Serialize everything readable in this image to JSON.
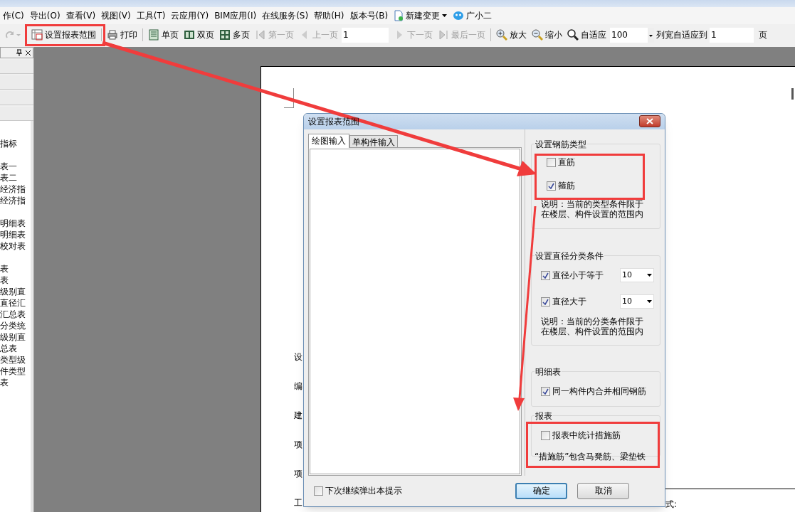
{
  "menu_bar": [
    {
      "label": "作(C)"
    },
    {
      "label": "导出(O)"
    },
    {
      "label": "查看(V)"
    },
    {
      "label": "视图(V)"
    },
    {
      "label": "工具(T)"
    },
    {
      "label": "云应用(Y)"
    },
    {
      "label": "BIM应用(I)"
    },
    {
      "label": "在线服务(S)"
    },
    {
      "label": "帮助(H)"
    },
    {
      "label": "版本号(B)"
    },
    {
      "label": "新建变更",
      "kind": "dropdown"
    },
    {
      "label": "广小二",
      "kind": "assistant"
    }
  ],
  "toolbar": [
    {
      "kind": "redo",
      "disabled": true
    },
    {
      "kind": "button",
      "label": "设置报表范围",
      "disabled": false
    },
    {
      "kind": "button",
      "label": "打印",
      "disabled": false
    },
    {
      "kind": "button",
      "label": "单页",
      "disabled": false
    },
    {
      "kind": "button",
      "label": "双页",
      "disabled": false
    },
    {
      "kind": "button",
      "label": "多页",
      "disabled": false
    },
    {
      "kind": "button",
      "label": "第一页",
      "disabled": true
    },
    {
      "kind": "button",
      "label": "上一页",
      "disabled": true
    },
    {
      "kind": "field",
      "value": "1"
    },
    {
      "kind": "button",
      "label": "下一页",
      "disabled": true
    },
    {
      "kind": "button",
      "label": "最后一页",
      "disabled": true
    },
    {
      "kind": "button",
      "label": "放大",
      "disabled": false
    },
    {
      "kind": "button",
      "label": "缩小",
      "disabled": false
    },
    {
      "kind": "button",
      "label": "自适应",
      "disabled": false
    },
    {
      "kind": "dropdown",
      "value": "100"
    },
    {
      "kind": "label",
      "label": "列宽自适应到"
    },
    {
      "kind": "field",
      "value": "1"
    },
    {
      "kind": "label",
      "label": "页"
    }
  ],
  "side_panel": {
    "groups": [
      {
        "items": [
          "指标"
        ]
      },
      {
        "items": [
          "表一",
          "表二",
          "经济指",
          "经济指"
        ]
      },
      {
        "items": [
          "明细表",
          "明细表",
          "校对表"
        ]
      },
      {
        "items": [
          "表",
          "表",
          "级别直",
          "直径汇",
          "汇总表",
          "分类统",
          "级别直",
          "总表",
          "类型级",
          "件类型",
          "表"
        ]
      }
    ]
  },
  "page": {
    "labels": [
      "设",
      "编",
      "建",
      "项",
      "项",
      "工"
    ],
    "footer_text": "式:"
  },
  "dialog": {
    "title": "设置报表范围",
    "tabs": [
      {
        "label": "绘图输入",
        "selected": true
      },
      {
        "label": "单构件输入",
        "selected": false
      }
    ],
    "groups": [
      {
        "title": "设置钢筋类型",
        "rows": [
          {
            "kind": "checkbox",
            "label": "直筋",
            "checked": false
          },
          {
            "kind": "checkbox",
            "label": "箍筋",
            "checked": true
          },
          {
            "kind": "note",
            "lines": [
              "说明：当前的类型条件限于",
              "在楼层、构件设置的范围内"
            ]
          }
        ]
      },
      {
        "title": "设置直径分类条件",
        "rows": [
          {
            "kind": "checkbox_select",
            "label": "直径小于等于",
            "checked": true,
            "value": "10"
          },
          {
            "kind": "checkbox_select",
            "label": "直径大于",
            "checked": true,
            "value": "10"
          },
          {
            "kind": "note",
            "lines": [
              "说明：当前的分类条件限于",
              "在楼层、构件设置的范围内"
            ]
          }
        ]
      },
      {
        "title": "明细表",
        "rows": [
          {
            "kind": "checkbox",
            "label": "同一构件内合并相同钢筋",
            "checked": true
          }
        ]
      },
      {
        "title": "报表",
        "rows": [
          {
            "kind": "checkbox",
            "label": "报表中统计措施筋",
            "checked": false
          },
          {
            "kind": "text",
            "text": "“措施筋”包含马凳筋、梁垫铁"
          }
        ]
      }
    ],
    "footer_checkbox": {
      "label": "下次继续弹出本提示",
      "checked": false
    },
    "buttons": [
      {
        "label": "确定",
        "default": true
      },
      {
        "label": "取消",
        "default": false
      }
    ]
  }
}
